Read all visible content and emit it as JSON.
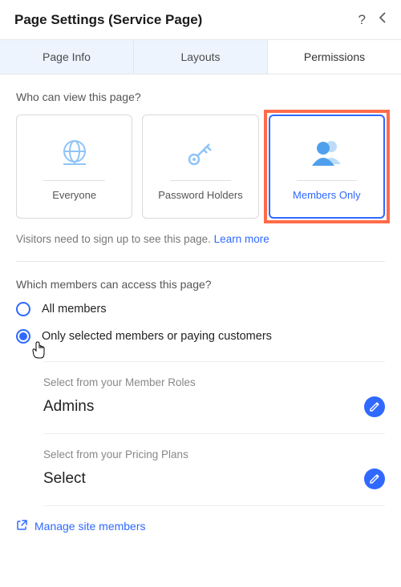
{
  "header": {
    "title": "Page Settings (Service Page)"
  },
  "tabs": {
    "info": "Page Info",
    "layouts": "Layouts",
    "permissions": "Permissions"
  },
  "view": {
    "question": "Who can view this page?",
    "options": {
      "everyone": "Everyone",
      "password": "Password Holders",
      "members": "Members Only"
    },
    "helper_text": "Visitors need to sign up to see this page. ",
    "learn_more": "Learn more"
  },
  "access": {
    "question": "Which members can access this page?",
    "all": "All members",
    "selected": "Only selected members or paying customers"
  },
  "roles": {
    "label": "Select from your Member Roles",
    "value": "Admins"
  },
  "plans": {
    "label": "Select from your Pricing Plans",
    "value": "Select"
  },
  "footer": {
    "manage": "Manage site members"
  }
}
